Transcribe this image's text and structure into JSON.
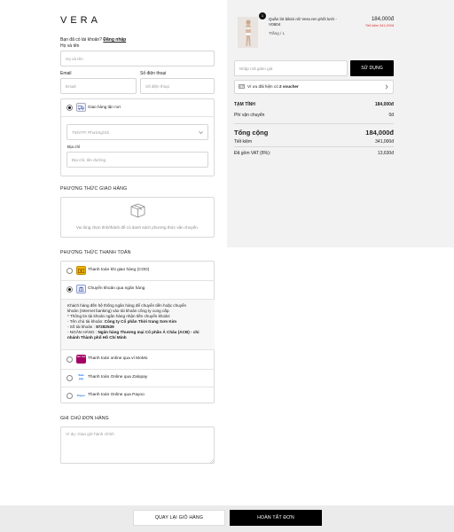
{
  "brand": {
    "logo": "VERA"
  },
  "account": {
    "prompt": "Bạn đã có tài khoản?",
    "login_link": "Đăng nhập"
  },
  "form": {
    "name_label": "Họ và tên",
    "name_placeholder": "Họ và tên",
    "email_label": "Email",
    "email_placeholder": "Email",
    "phone_label": "Số điện thoại",
    "phone_placeholder": "Số điện thoại",
    "delivery_option": "Giao hàng tận nơi",
    "province_placeholder": "Tỉnh/TP, Phường/Xã",
    "address_label": "Địa chỉ",
    "address_placeholder": "Địa chỉ, tên đường"
  },
  "shipping": {
    "title": "PHƯƠNG THỨC GIAO HÀNG",
    "empty_text": "Vui lòng chọn tỉnh/thành để có danh sách phương thức vận chuyển."
  },
  "payment": {
    "title": "PHƯƠNG THỨC THANH TOÁN",
    "methods": [
      {
        "label": "Thanh toán khi giao hàng (COD)",
        "selected": false
      },
      {
        "label": "Chuyển khoản qua ngân hàng",
        "selected": true
      },
      {
        "label": "Thanh toán online qua ví MoMo",
        "selected": false
      },
      {
        "label": "Thanh toán Online qua Zalopay",
        "selected": false
      },
      {
        "label": "Thanh toán Online qua Payoo",
        "selected": false
      }
    ],
    "bank_info": {
      "line1": "Khách hàng đến hệ thống ngân hàng để chuyển tiền hoặc chuyển",
      "line2": "khoản (Internet banking) vào tài khoản công ty cung cấp.",
      "line3": "* Thông tin tài khoản ngân hàng nhận tiền chuyển khoản:",
      "line4_prefix": "- Tên chủ tài khoản: ",
      "line4_value": "Công ty Cổ phần Thời trang Sơn Kim",
      "line5_prefix": "- Số tài khoản : ",
      "line5_value": "87282539",
      "line6_prefix": "- NGÂN HÀNG : ",
      "line6_value": "Ngân hàng Thương mại Cổ phần Á Châu (ACB) - chi",
      "line7_value": "nhánh Thành phố Hồ Chí Minh"
    },
    "icons": {
      "momo": "mo mo",
      "zalopay": "Zalo pay",
      "payoo": "Payoo"
    }
  },
  "note": {
    "title": "GHI CHÚ ĐƠN HÀNG",
    "placeholder": "Ví dụ: Giao giờ hành chính"
  },
  "cart": {
    "qty": "1",
    "product_name_1": "Quần lót bikini nữ Vera ren phối lưới -",
    "product_name_2": "V0604",
    "variant": "Trắng / L",
    "price": "184,000đ",
    "saving": "Tiết kiệm 341,000đ"
  },
  "discount": {
    "placeholder": "Nhập mã giảm giá",
    "apply_label": "SỬ DỤNG"
  },
  "voucher": {
    "prefix": "Ví ưu đãi hiện có ",
    "count": "2 voucher"
  },
  "summary": {
    "subtotal_label": "TẠM TÍNH",
    "subtotal": "184,000đ",
    "shipping_label": "Phí vận chuyển",
    "shipping": "0đ",
    "total_label": "Tổng cộng",
    "total": "184,000đ",
    "saving_label": "Tiết kiệm",
    "saving": "341,000đ",
    "vat_label": "Đã gồm VAT (8%):",
    "vat": "13,630đ"
  },
  "actions": {
    "back_label": "QUAY LẠI GIỎ HÀNG",
    "complete_label": "HOÀN TẤT ĐƠN"
  }
}
